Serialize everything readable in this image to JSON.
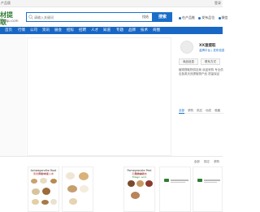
{
  "topbar": {
    "left_text": "产品版",
    "right_text": "登录"
  },
  "logo": {
    "main": "材提取",
    "sub": "yqtiqu.com"
  },
  "search": {
    "placeholder": "请输入关键词",
    "scope": "找结",
    "button": "搜索"
  },
  "header_links": [
    "在产品推",
    "发布品位",
    "微信"
  ],
  "nav": {
    "items": [
      "首页",
      "行情",
      "公司",
      "资讯",
      "展会",
      "招标",
      "招聘",
      "人才",
      "知道",
      "专题",
      "品牌",
      "技术",
      "商圈"
    ]
  },
  "profile": {
    "name": "XX速提取",
    "meta": "金牌平台 | 发布信息",
    "buttons": [
      "商品信息",
      "联系方式"
    ],
    "description": "植物提取物供应商 欢迎采购 专业供应各类天然提取物产品 质量保证",
    "tabs": [
      "全部",
      "求购",
      "供应",
      "动态",
      "收藏"
    ]
  },
  "products": {
    "links": [
      "全部",
      "供应",
      "求购"
    ],
    "cards": [
      {
        "title": "Ashwagandha Root Extract",
        "subtitle": "南非醉茄 印度人参",
        "tag": ""
      },
      {
        "title": "",
        "subtitle": "",
        "tag": ""
      },
      {
        "title": "Pomegranate Peel Extract",
        "subtitle": "石榴皮提取物",
        "tag": "Ellagic acid"
      },
      {
        "title": "",
        "subtitle": "",
        "tag": ""
      },
      {
        "title": "",
        "subtitle": "",
        "tag": ""
      }
    ]
  },
  "colors": {
    "brand": "#1967c4",
    "accent": "#2e7d32"
  }
}
